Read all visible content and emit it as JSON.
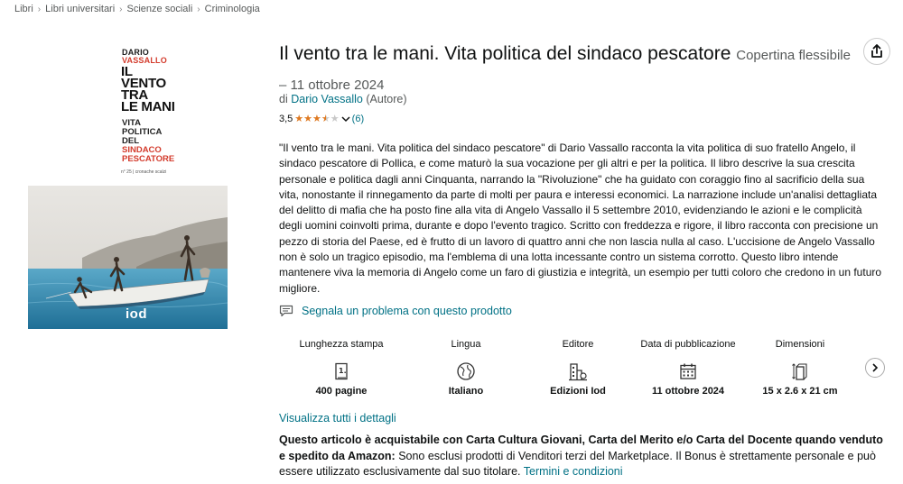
{
  "breadcrumb": [
    "Libri",
    "Libri universitari",
    "Scienze sociali",
    "Criminologia"
  ],
  "cover": {
    "author_first": "DARIO",
    "author_last": "VASSALLO",
    "title_lines": [
      "IL",
      "VENTO",
      "TRA",
      "LE MANI"
    ],
    "subtitle_lines": [
      "VITA",
      "POLITICA",
      "DEL"
    ],
    "subtitle_red_lines": [
      "SINDACO",
      "PESCATORE"
    ],
    "series": "n° 25 | cronache scalzi",
    "publisher_logo": "iod"
  },
  "product": {
    "title": "Il vento tra le mani. Vita politica del sindaco pescatore",
    "binding": "Copertina flessibile",
    "date": "– 11 ottobre 2024",
    "by_prefix": "di",
    "author": "Dario Vassallo",
    "author_role": "(Autore)",
    "rating_value": "3,5",
    "rating_stars": 3.5,
    "rating_count": "(6)"
  },
  "description": "\"Il vento tra le mani. Vita politica del sindaco pescatore\" di Dario Vassallo racconta la vita politica di suo fratello Angelo, il sindaco pescatore di Pollica, e come maturò la sua vocazione per gli altri e per la politica. Il libro descrive la sua crescita personale e politica dagli anni Cinquanta, narrando la \"Rivoluzione\" che ha guidato con coraggio fino al sacrificio della sua vita, nonostante il rinnegamento da parte di molti per paura e interessi economici. La narrazione include un'analisi dettagliata del delitto di mafia che ha posto fine alla vita di Angelo Vassallo il 5 settembre 2010, evidenziando le azioni e le complicità degli uomini coinvolti prima, durante e dopo l'evento tragico. Scritto con freddezza e rigore, il libro racconta con precisione un pezzo di storia del Paese, ed è frutto di un lavoro di quattro anni che non lascia nulla al caso. L'uccisione de Angelo Vassallo non è solo un tragico episodio, ma l'emblema di una lotta incessante contro un sistema corrotto. Questo libro intende mantenere viva la memoria di Angelo come un faro di giustizia e integrità, un esempio per tutti coloro che credono in un futuro migliore.",
  "report_link": "Segnala un problema con questo prodotto",
  "specs": [
    {
      "label": "Lunghezza stampa",
      "icon": "page-count-icon",
      "value": "400 pagine"
    },
    {
      "label": "Lingua",
      "icon": "globe-icon",
      "value": "Italiano"
    },
    {
      "label": "Editore",
      "icon": "publisher-building-icon",
      "value": "Edizioni Iod"
    },
    {
      "label": "Data di pubblicazione",
      "icon": "calendar-icon",
      "value": "11 ottobre 2024"
    },
    {
      "label": "Dimensioni",
      "icon": "dimensions-icon",
      "value": "15 x 2.6 x 21 cm"
    }
  ],
  "details_link": "Visualizza tutti i dettagli",
  "notice": {
    "bold": "Questo articolo è acquistabile con Carta Cultura Giovani, Carta del Merito e/o Carta del Docente quando venduto e spedito da Amazon:",
    "text": " Sono esclusi prodotti di Venditori terzi del Marketplace. Il Bonus è strettamente personale e può essere utilizzato esclusivamente dal suo titolare.",
    "link": "Termini e condizioni"
  },
  "colors": {
    "link": "#007185",
    "star": "#de7921",
    "cover_red": "#d33b2c",
    "sea": "#2b8bb0"
  }
}
